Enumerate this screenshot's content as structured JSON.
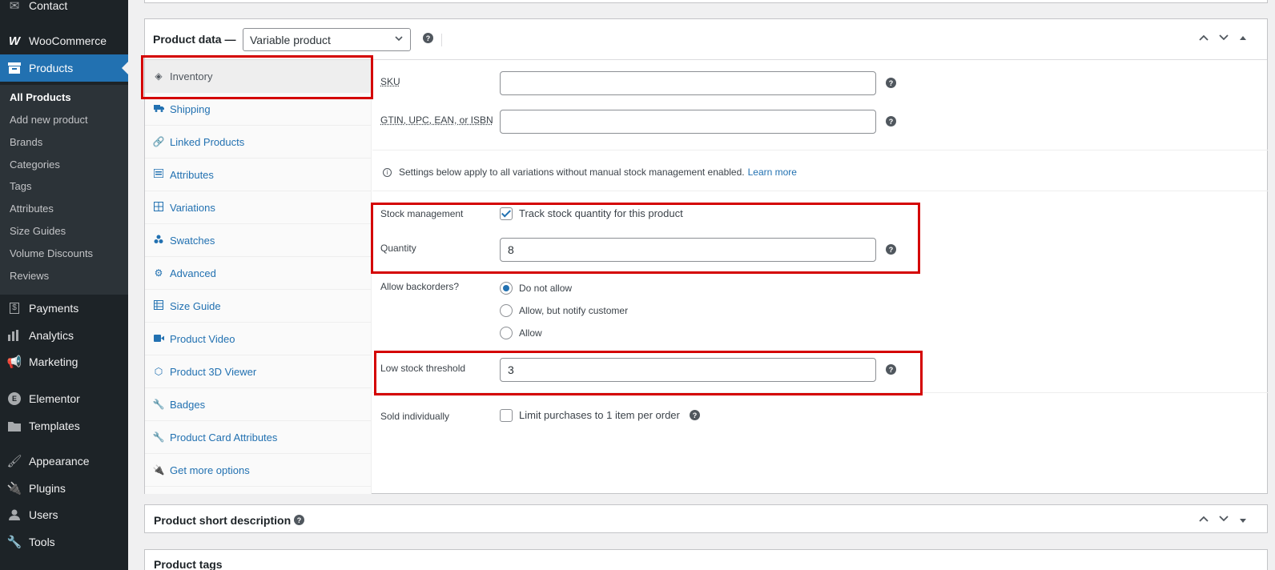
{
  "sidebar": {
    "menu": [
      {
        "label": "Contact",
        "icon": "mail-icon"
      },
      {
        "label": "WooCommerce",
        "icon": "woocommerce-icon"
      },
      {
        "label": "Products",
        "icon": "archive-icon"
      },
      {
        "label": "Payments",
        "icon": "payments-icon"
      },
      {
        "label": "Analytics",
        "icon": "bar-chart-icon"
      },
      {
        "label": "Marketing",
        "icon": "megaphone-icon"
      },
      {
        "label": "Elementor",
        "icon": "elementor-icon"
      },
      {
        "label": "Templates",
        "icon": "folder-icon"
      },
      {
        "label": "Appearance",
        "icon": "paintbrush-icon"
      },
      {
        "label": "Plugins",
        "icon": "plugin-icon"
      },
      {
        "label": "Users",
        "icon": "user-icon"
      },
      {
        "label": "Tools",
        "icon": "wrench-icon"
      }
    ],
    "submenu": [
      "All Products",
      "Add new product",
      "Brands",
      "Categories",
      "Tags",
      "Attributes",
      "Size Guides",
      "Volume Discounts",
      "Reviews"
    ]
  },
  "product_data": {
    "title": "Product data —",
    "type_value": "Variable product",
    "tabs": [
      {
        "label": "Inventory",
        "icon": "tag-icon"
      },
      {
        "label": "Shipping",
        "icon": "truck-icon"
      },
      {
        "label": "Linked Products",
        "icon": "link-icon"
      },
      {
        "label": "Attributes",
        "icon": "list-icon"
      },
      {
        "label": "Variations",
        "icon": "grid-icon"
      },
      {
        "label": "Swatches",
        "icon": "swatches-icon"
      },
      {
        "label": "Advanced",
        "icon": "gear-icon"
      },
      {
        "label": "Size Guide",
        "icon": "table-icon"
      },
      {
        "label": "Product Video",
        "icon": "video-icon"
      },
      {
        "label": "Product 3D Viewer",
        "icon": "cube-icon"
      },
      {
        "label": "Badges",
        "icon": "wrench-icon"
      },
      {
        "label": "Product Card Attributes",
        "icon": "wrench-icon"
      },
      {
        "label": "Get more options",
        "icon": "plugin-icon"
      }
    ],
    "sku": {
      "label": "SKU",
      "value": ""
    },
    "gtin": {
      "label": "GTIN, UPC, EAN, or ISBN",
      "value": ""
    },
    "notice": {
      "text": "Settings below apply to all variations without manual stock management enabled.",
      "link": "Learn more"
    },
    "stock_management": {
      "label": "Stock management",
      "checkbox_label": "Track stock quantity for this product",
      "checked": true
    },
    "quantity": {
      "label": "Quantity",
      "value": "8"
    },
    "backorders": {
      "label": "Allow backorders?",
      "options": [
        "Do not allow",
        "Allow, but notify customer",
        "Allow"
      ],
      "selected": "Do not allow"
    },
    "low_stock": {
      "label": "Low stock threshold",
      "value": "3"
    },
    "sold_individually": {
      "label": "Sold individually",
      "checkbox_label": "Limit purchases to 1 item per order",
      "checked": false
    }
  },
  "short_description": {
    "title": "Product short description"
  },
  "bottom_panel": {
    "title": "Product tags"
  },
  "colors": {
    "accent": "#2271b1",
    "sidebar": "#1d2327",
    "highlight": "#d40000"
  }
}
